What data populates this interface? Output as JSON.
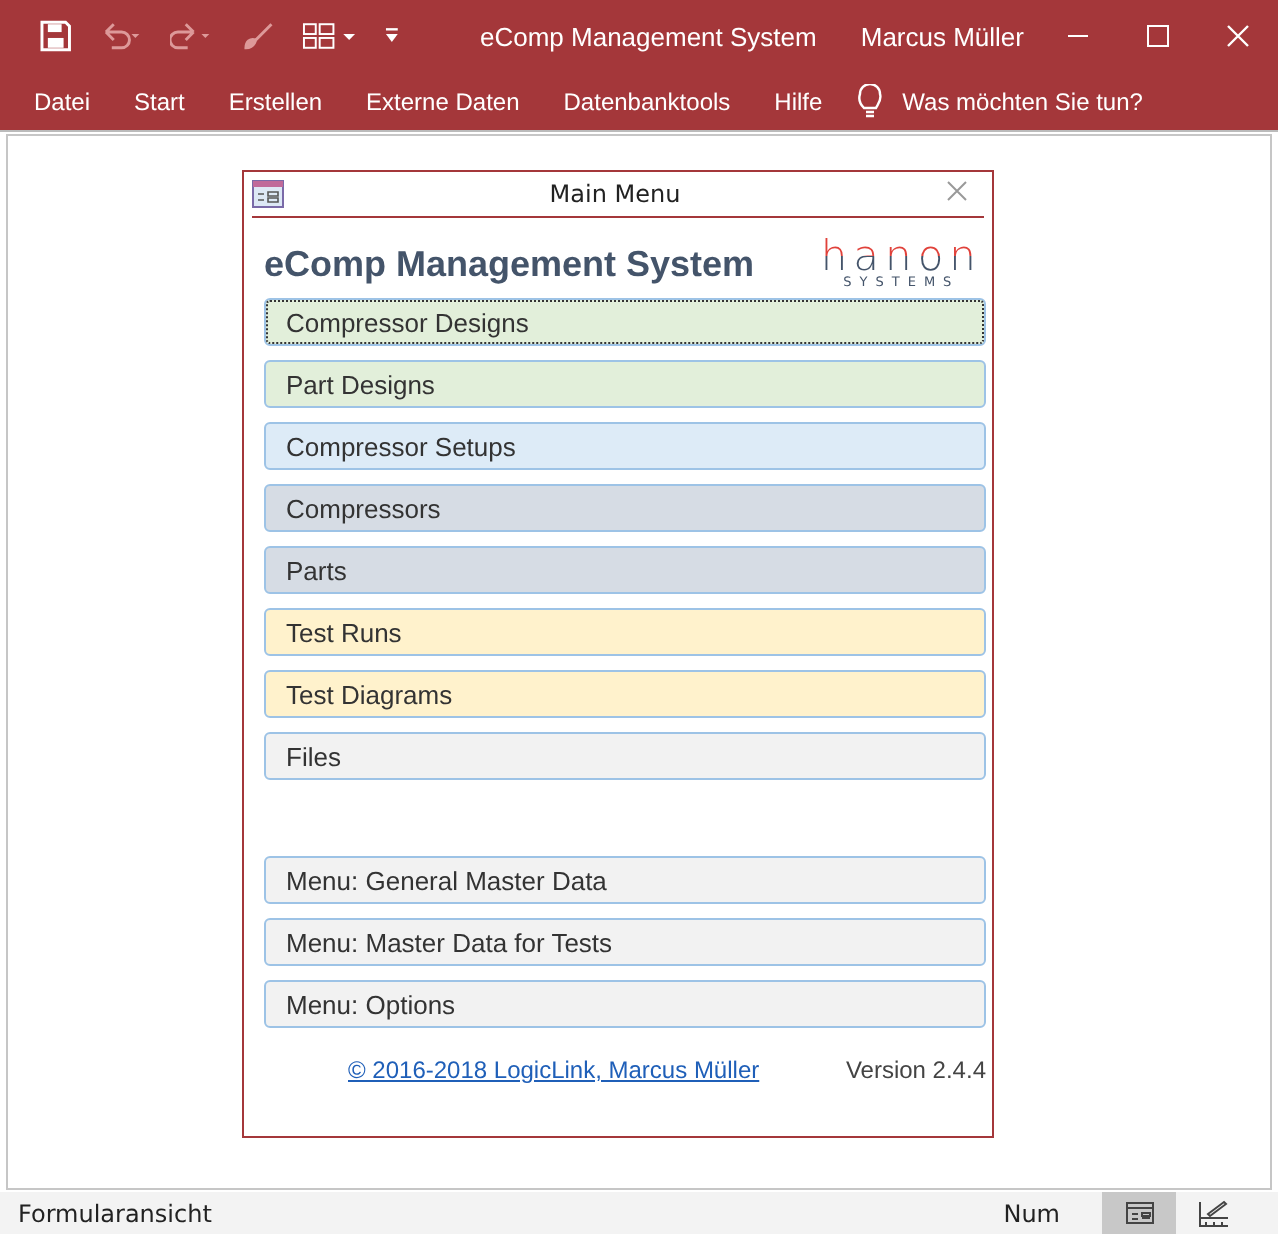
{
  "window": {
    "title": "eComp Management System",
    "user": "Marcus Müller"
  },
  "ribbon_tabs": [
    "Datei",
    "Start",
    "Erstellen",
    "Externe Daten",
    "Datenbanktools",
    "Hilfe"
  ],
  "tell_me": {
    "placeholder": "Was möchten Sie tun?"
  },
  "form": {
    "title": "Main Menu",
    "heading": "eComp Management System",
    "logo": {
      "name": "hanon",
      "tagline": "SYSTEMS"
    },
    "button_groups": [
      [
        {
          "label": "Compressor Designs",
          "color": "#e2efda",
          "focused": true
        },
        {
          "label": "Part Designs",
          "color": "#e2efda",
          "focused": false
        },
        {
          "label": "Compressor Setups",
          "color": "#ddebf7",
          "focused": false
        },
        {
          "label": "Compressors",
          "color": "#d6dce4",
          "focused": false
        },
        {
          "label": "Parts",
          "color": "#d6dce4",
          "focused": false
        },
        {
          "label": "Test Runs",
          "color": "#fff2cc",
          "focused": false
        },
        {
          "label": "Test Diagrams",
          "color": "#fff2cc",
          "focused": false
        },
        {
          "label": "Files",
          "color": "#f2f2f2",
          "focused": false
        }
      ],
      [
        {
          "label": "Menu: General Master Data",
          "color": "#f2f2f2",
          "focused": false
        },
        {
          "label": "Menu: Master Data for Tests",
          "color": "#f2f2f2",
          "focused": false
        },
        {
          "label": "Menu: Options",
          "color": "#f2f2f2",
          "focused": false
        }
      ]
    ],
    "copyright_link": "© 2016-2018 LogicLink, Marcus Müller",
    "version": "Version 2.4.4"
  },
  "status_bar": {
    "view": "Formularansicht",
    "num": "Num",
    "views": [
      {
        "kind": "form",
        "selected": true
      },
      {
        "kind": "design",
        "selected": false
      }
    ]
  }
}
